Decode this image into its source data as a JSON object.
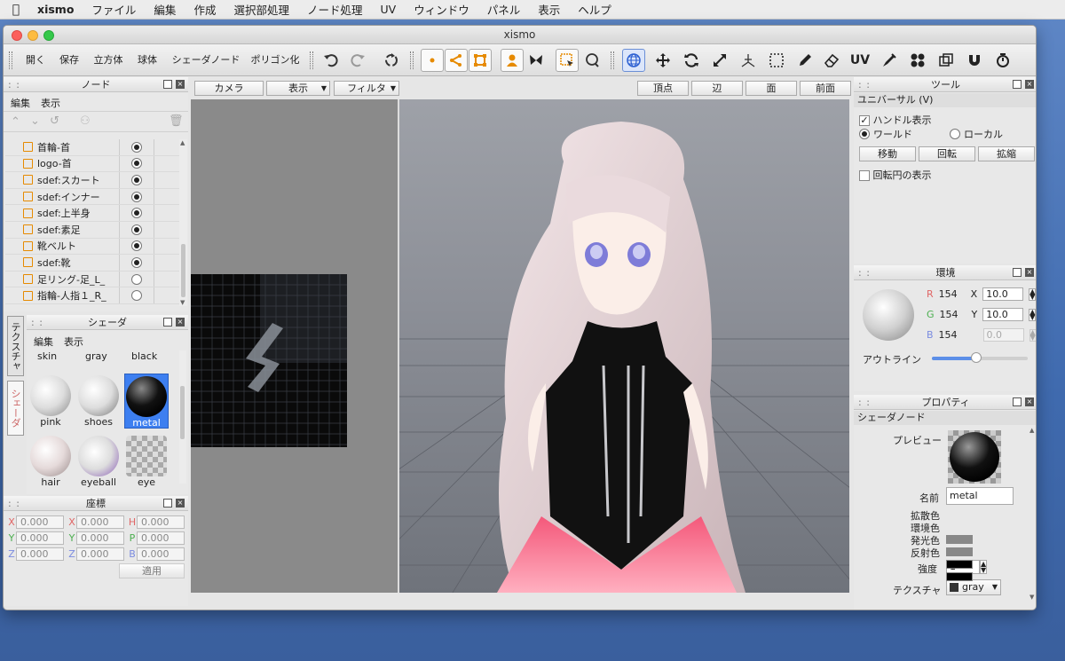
{
  "menubar": {
    "app": "xismo",
    "items": [
      "ファイル",
      "編集",
      "作成",
      "選択部処理",
      "ノード処理",
      "UV",
      "ウィンドウ",
      "パネル",
      "表示",
      "ヘルプ"
    ]
  },
  "window": {
    "title": "xismo"
  },
  "toolbar": {
    "open": "開く",
    "save": "保存",
    "cube": "立方体",
    "sphere": "球体",
    "shader_node": "シェーダノード",
    "polygonize": "ポリゴン化",
    "uv_icon": "UV"
  },
  "node_panel": {
    "title": "ノード",
    "menu": [
      "編集",
      "表示"
    ],
    "items": [
      {
        "label": "首輪-首",
        "on": true
      },
      {
        "label": "logo-首",
        "on": true
      },
      {
        "label": "sdef:スカート",
        "on": true
      },
      {
        "label": "sdef:インナー",
        "on": true
      },
      {
        "label": "sdef:上半身",
        "on": true
      },
      {
        "label": "sdef:素足",
        "on": true
      },
      {
        "label": "靴ベルト",
        "on": true
      },
      {
        "label": "sdef:靴",
        "on": true
      },
      {
        "label": "足リング-足_L_",
        "on": false
      },
      {
        "label": "指輪-人指１_R_",
        "on": false
      }
    ]
  },
  "shader_panel": {
    "title": "シェーダ",
    "menu": [
      "編集",
      "表示"
    ],
    "top_labels": [
      "skin",
      "gray",
      "black"
    ],
    "thumbs": [
      {
        "label": "pink"
      },
      {
        "label": "shoes"
      },
      {
        "label": "metal"
      },
      {
        "label": "hair"
      },
      {
        "label": "eyeball"
      },
      {
        "label": "eye"
      }
    ]
  },
  "side_tabs": [
    "テクスチャ",
    "シェーダ"
  ],
  "coord_panel": {
    "title": "座標",
    "rows": [
      {
        "a": "X",
        "av": "0.000",
        "b": "X",
        "bv": "0.000",
        "c": "H",
        "cv": "0.000"
      },
      {
        "a": "Y",
        "av": "0.000",
        "b": "Y",
        "bv": "0.000",
        "c": "P",
        "cv": "0.000"
      },
      {
        "a": "Z",
        "av": "0.000",
        "b": "Z",
        "bv": "0.000",
        "c": "B",
        "cv": "0.000"
      }
    ],
    "apply": "適用"
  },
  "viewport": {
    "camera": "カメラ",
    "view": "表示",
    "filter": "フィルタ",
    "modes": [
      "頂点",
      "辺",
      "面",
      "前面"
    ]
  },
  "tool_panel": {
    "title": "ツール",
    "mode": "ユニバーサル (V)",
    "handle": "ハンドル表示",
    "world": "ワールド",
    "local": "ローカル",
    "move": "移動",
    "rotate": "回転",
    "scale": "拡縮",
    "rot_circle": "回転円の表示"
  },
  "env_panel": {
    "title": "環境",
    "r_label": "R",
    "r": "154",
    "g_label": "G",
    "g": "154",
    "b_label": "B",
    "b": "154",
    "x_label": "X",
    "x": "10.0",
    "y_label": "Y",
    "y": "10.0",
    "z": "0.0",
    "outline": "アウトライン",
    "outline_level": 0.46
  },
  "prop_panel": {
    "title": "プロパティ",
    "section": "シェーダノード",
    "preview": "プレビュー",
    "name_label": "名前",
    "name_value": "metal",
    "diffuse": "拡散色",
    "ambient": "環境色",
    "emissive": "発光色",
    "specular": "反射色",
    "strength_label": "強度",
    "strength": "1",
    "texture_label": "テクスチャ",
    "texture": "gray"
  },
  "colors": {
    "accent": "#e68a00",
    "select": "#3d7ff0"
  }
}
